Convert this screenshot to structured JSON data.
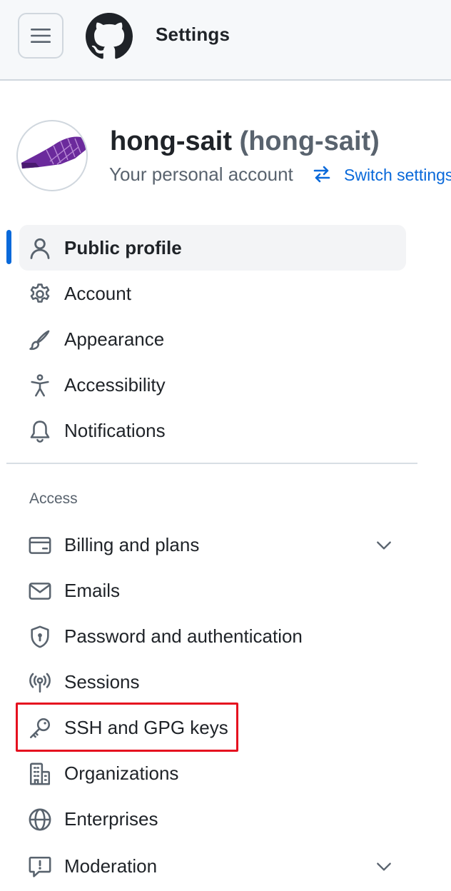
{
  "header": {
    "title": "Settings",
    "menu_icon": "hamburger-icon",
    "logo_icon": "github-mark-icon"
  },
  "profile": {
    "name": "hong-sait",
    "handle": "(hong-sait)",
    "subtitle": "Your personal account",
    "switch_label": "Switch settings"
  },
  "nav": {
    "items": [
      {
        "label": "Public profile",
        "icon": "person-icon",
        "active": true
      },
      {
        "label": "Account",
        "icon": "gear-icon"
      },
      {
        "label": "Appearance",
        "icon": "paintbrush-icon"
      },
      {
        "label": "Accessibility",
        "icon": "accessibility-icon"
      },
      {
        "label": "Notifications",
        "icon": "bell-icon"
      }
    ],
    "access_section": "Access",
    "access_items": [
      {
        "label": "Billing and plans",
        "icon": "credit-card-icon",
        "expandable": true
      },
      {
        "label": "Emails",
        "icon": "mail-icon"
      },
      {
        "label": "Password and authentication",
        "icon": "shield-lock-icon"
      },
      {
        "label": "Sessions",
        "icon": "broadcast-icon"
      },
      {
        "label": "SSH and GPG keys",
        "icon": "key-icon",
        "highlighted": true
      },
      {
        "label": "Organizations",
        "icon": "organization-icon"
      },
      {
        "label": "Enterprises",
        "icon": "globe-icon"
      },
      {
        "label": "Moderation",
        "icon": "report-icon",
        "expandable": true
      }
    ]
  },
  "colors": {
    "accent": "#0969da",
    "highlight": "#e5101f",
    "active_bg": "#f3f4f6",
    "avatar_purple": "#6b2a9c"
  }
}
